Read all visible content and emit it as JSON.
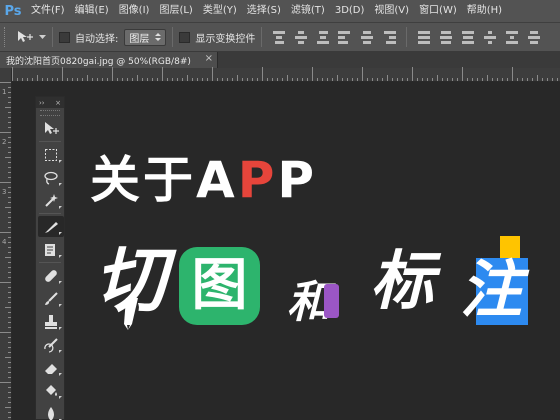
{
  "app": {
    "logo": "Ps"
  },
  "menu": [
    "文件(F)",
    "编辑(E)",
    "图像(I)",
    "图层(L)",
    "类型(Y)",
    "选择(S)",
    "滤镜(T)",
    "3D(D)",
    "视图(V)",
    "窗口(W)",
    "帮助(H)"
  ],
  "options": {
    "auto_select_label": "自动选择:",
    "auto_select_value": "图层",
    "show_transform_label": "显示变换控件"
  },
  "document": {
    "tab_label": "我的沈阳首页0820gai.jpg @ 50%(RGB/8#)",
    "close_glyph": "×"
  },
  "tools_panel": {
    "collapse_glyph": "››",
    "close_glyph": "×"
  },
  "canvas": {
    "headline_prefix": "关于A",
    "headline_red": "P",
    "headline_suffix": "P",
    "word_qie": "切",
    "word_tu": "图",
    "word_he": "和",
    "word_biao": "标",
    "word_zhu": "注",
    "colors": {
      "red": "#e6453b",
      "green": "#2db46d",
      "purple": "#9b56c5",
      "yellow": "#ffc400",
      "blue": "#2d8af0"
    }
  },
  "ruler_left_numbers": [
    "1",
    "2",
    "3",
    "4"
  ]
}
